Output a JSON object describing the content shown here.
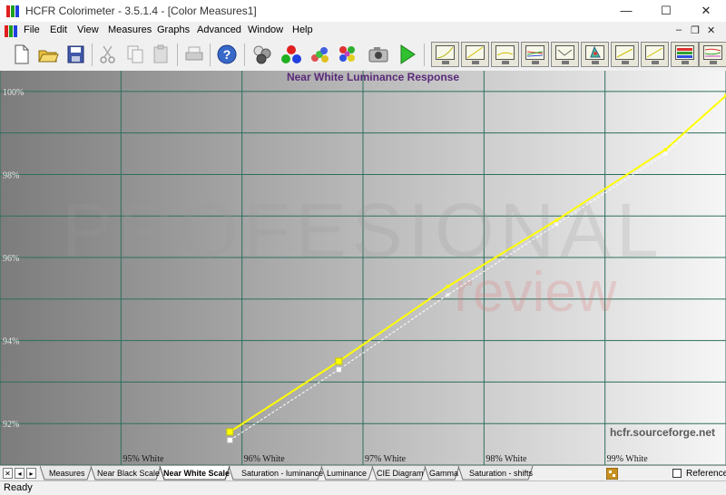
{
  "window": {
    "title": "HCFR Colorimeter - 3.5.1.4 - [Color Measures1]",
    "minimize_glyph": "—",
    "maximize_glyph": "☐",
    "close_glyph": "✕"
  },
  "menu": {
    "items": [
      "File",
      "Edit",
      "View",
      "Measures",
      "Graphs",
      "Advanced",
      "Window",
      "Help"
    ],
    "mdi_minimize": "–",
    "mdi_restore": "❐",
    "mdi_close": "✕"
  },
  "toolbar": {
    "buttons": [
      "new-document",
      "open-folder",
      "save-disk",
      "cut-scissors",
      "copy",
      "paste",
      "print",
      "help",
      "gray-balls",
      "rgb-balls",
      "saturation-balls",
      "multi-balls",
      "camera",
      "play-measure"
    ],
    "graph_buttons": [
      "gamma-graph",
      "luminance-graph",
      "near-black-graph",
      "rgb-levels-graph",
      "delta-e-graph",
      "cie-diagram",
      "near-white-graph",
      "saturation-graph",
      "color-temp-graph",
      "saturation-shift-graph"
    ]
  },
  "chart_data": {
    "type": "line",
    "title": "Near White Luminance Response",
    "watermark_top": "PROFESIONAL",
    "watermark_bottom": "review",
    "credit": "hcfr.sourceforge.net",
    "x_tick_labels": [
      "95% White",
      "96% White",
      "97% White",
      "98% White",
      "99% White"
    ],
    "y_tick_labels": [
      "92%",
      "94%",
      "96%",
      "98%",
      "100%"
    ],
    "xlim": [
      94,
      100
    ],
    "ylim": [
      91,
      100.5
    ],
    "grid": true,
    "series": [
      {
        "role": "measured",
        "color": "#ffff00",
        "x": [
          95.9,
          96.8,
          97.7,
          98.6,
          99.5,
          100
        ],
        "y": [
          91.8,
          93.5,
          95.3,
          96.9,
          98.6,
          99.9
        ]
      },
      {
        "role": "reference",
        "color": "#ffffff",
        "dashed": true,
        "x": [
          95.9,
          96.8,
          97.7,
          98.6,
          99.5,
          100
        ],
        "y": [
          91.6,
          93.3,
          95.1,
          96.8,
          98.5,
          99.9
        ]
      }
    ]
  },
  "bottom_tabs": {
    "tabs": [
      "Measures",
      "Near Black Scale",
      "Near White Scale",
      "Saturation - luminance",
      "Luminance",
      "CIE Diagram",
      "Gamma",
      "Saturation - shifts"
    ],
    "active_index": 2,
    "reference_label": "Reference",
    "nav": [
      "✕",
      "◂",
      "▸"
    ]
  },
  "status": {
    "text": "Ready"
  }
}
